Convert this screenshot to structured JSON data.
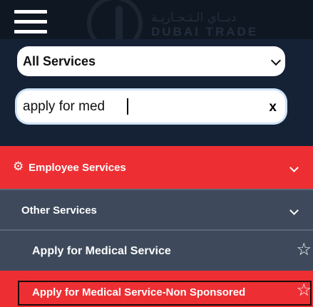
{
  "header": {
    "logo_arabic": "دبــاي الـتـجـاريـة",
    "logo_text": "DUBAI TRADE"
  },
  "search": {
    "category": "All Services",
    "query": "apply for med",
    "clear_label": "x"
  },
  "menu": {
    "employee_services": "Employee Services",
    "other_services": "Other Services",
    "items": [
      {
        "label": "Apply for Medical Service"
      },
      {
        "label": "Apply for Medical Service-Non Sponsored"
      }
    ]
  },
  "colors": {
    "topbar": "#0f1722",
    "panel": "#152236",
    "accent_red": "#ed2f33",
    "row_gray": "#3e4a5b"
  }
}
